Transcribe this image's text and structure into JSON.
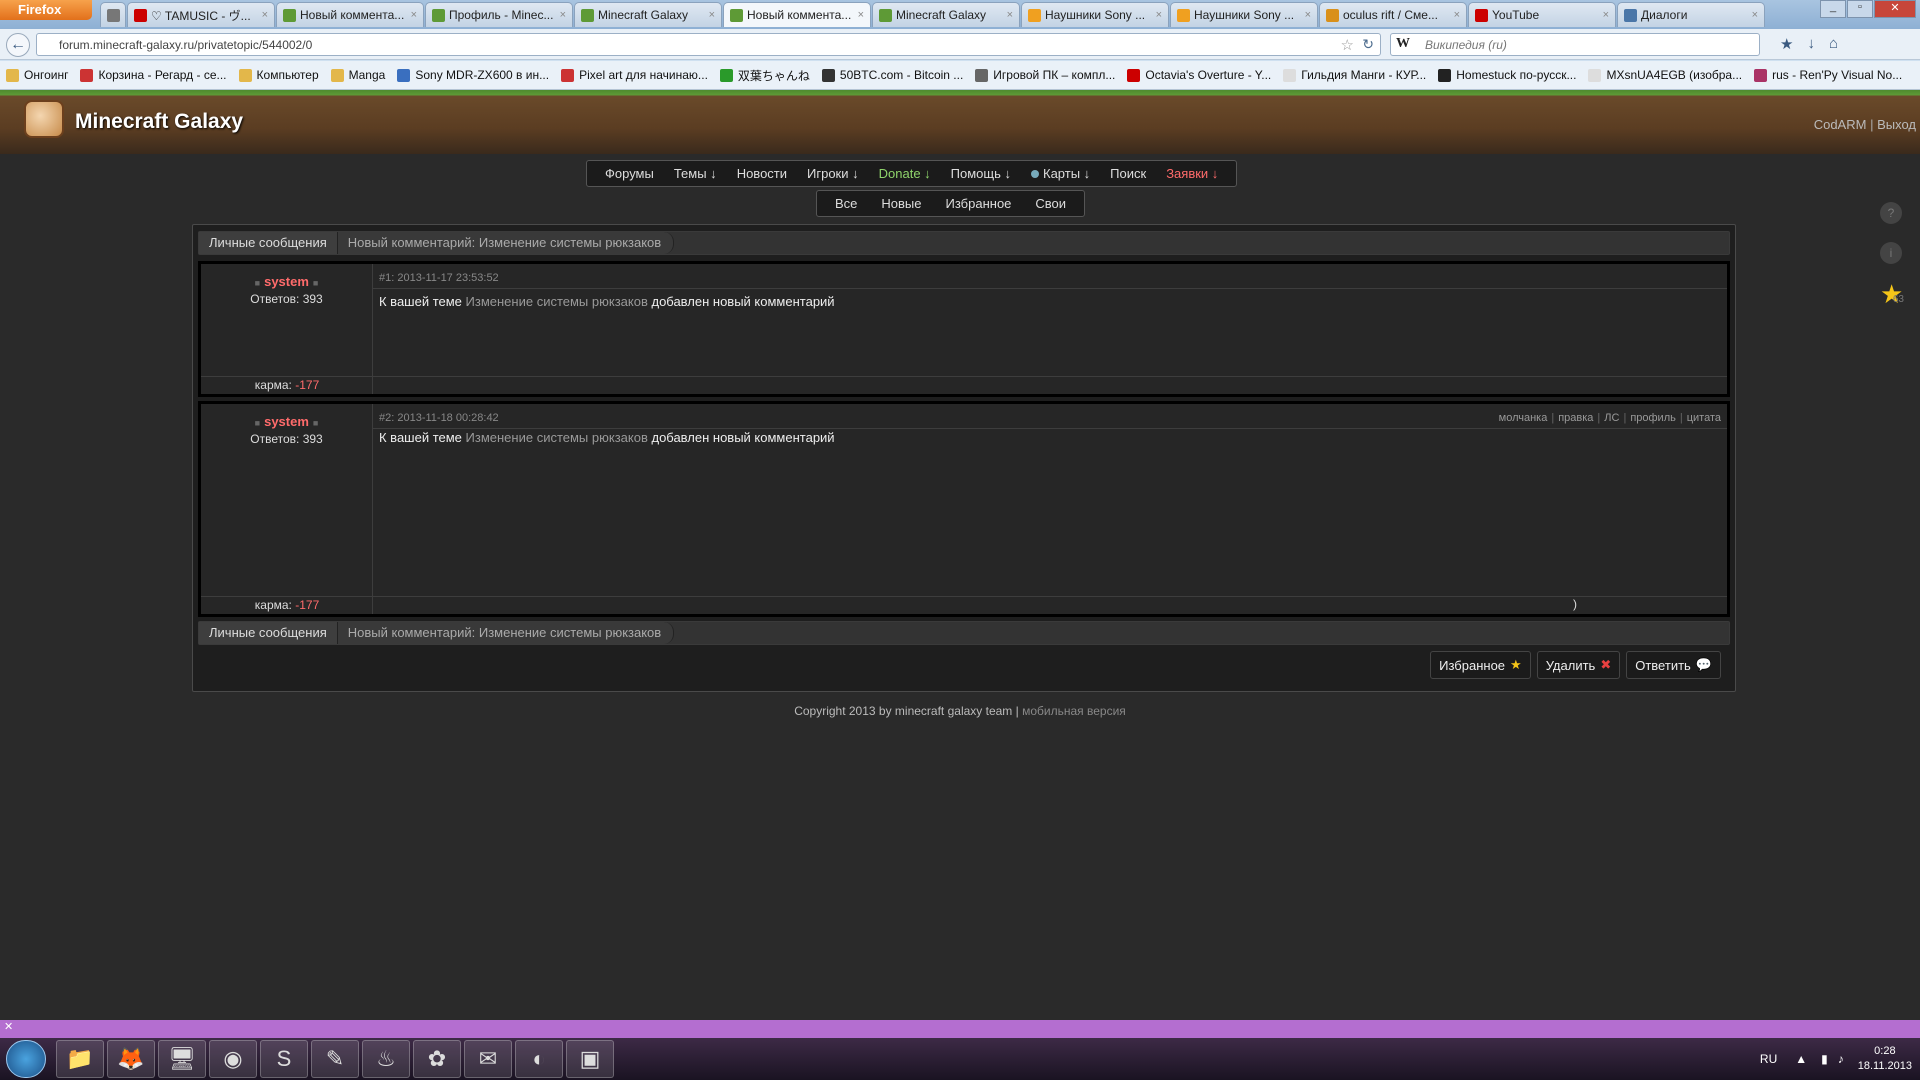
{
  "browser": {
    "menu_button": "Firefox",
    "tabs": [
      {
        "title": "♡ TAMUSIC - ヴ...",
        "favicon_color": "#cc0000"
      },
      {
        "title": "Новый коммента...",
        "favicon_color": "#5e9a36"
      },
      {
        "title": "Профиль - Minec...",
        "favicon_color": "#5e9a36"
      },
      {
        "title": "Minecraft Galaxy",
        "favicon_color": "#5e9a36"
      },
      {
        "title": "Новый коммента...",
        "favicon_color": "#5e9a36",
        "active": true
      },
      {
        "title": "Minecraft Galaxy",
        "favicon_color": "#5e9a36"
      },
      {
        "title": "Наушники Sony ...",
        "favicon_color": "#f0a020"
      },
      {
        "title": "Наушники Sony ...",
        "favicon_color": "#f0a020"
      },
      {
        "title": "oculus rift / Сме...",
        "favicon_color": "#d9901a"
      },
      {
        "title": "YouTube",
        "favicon_color": "#cc0000"
      },
      {
        "title": "Диалоги",
        "favicon_color": "#4a76a8"
      }
    ],
    "url": "forum.minecraft-galaxy.ru/privatetopic/544002/0",
    "search_placeholder": "Википедия (ru)",
    "bookmarks": [
      {
        "label": "Онгоинг",
        "color": "#e3b74a"
      },
      {
        "label": "Корзина - Регард - се...",
        "color": "#cc3333"
      },
      {
        "label": "Компьютер",
        "color": "#e3b74a"
      },
      {
        "label": "Manga",
        "color": "#e3b74a"
      },
      {
        "label": "Sony MDR-ZX600 в ин...",
        "color": "#3a6fbf"
      },
      {
        "label": "Pixel art для начинаю...",
        "color": "#cc3333"
      },
      {
        "label": "双葉ちゃんね",
        "color": "#2a9a2a"
      },
      {
        "label": "50BTC.com - Bitcoin ...",
        "color": "#333333"
      },
      {
        "label": "Игровой ПК – компл...",
        "color": "#666666"
      },
      {
        "label": "Octavia's Overture - Y...",
        "color": "#cc0000"
      },
      {
        "label": "Гильдия Манги - КУР...",
        "color": "#dddddd"
      },
      {
        "label": "Homestuck по-русск...",
        "color": "#222222"
      },
      {
        "label": "MXsnUA4EGB (изобра...",
        "color": "#dddddd"
      },
      {
        "label": "rus - Ren'Py Visual No...",
        "color": "#aa3366"
      }
    ]
  },
  "site": {
    "title": "Minecraft Galaxy",
    "user_link": "CodARM",
    "logout_link": "Выход",
    "separator": "|",
    "main_nav": [
      {
        "label": "Форумы",
        "style": "normal"
      },
      {
        "label": "Темы ↓",
        "style": "normal"
      },
      {
        "label": "Новости",
        "style": "normal"
      },
      {
        "label": "Игроки ↓",
        "style": "normal"
      },
      {
        "label": "Donate ↓",
        "style": "green"
      },
      {
        "label": "Помощь ↓",
        "style": "normal"
      },
      {
        "label": "Карты ↓",
        "style": "normal",
        "dot": true
      },
      {
        "label": "Поиск",
        "style": "normal"
      },
      {
        "label": "Заявки ↓",
        "style": "red"
      }
    ],
    "sub_nav": [
      "Все",
      "Новые",
      "Избранное",
      "Свои"
    ],
    "side_icons": {
      "help": "?",
      "info": "i",
      "star_count": "63"
    }
  },
  "topic": {
    "breadcrumb_root": "Личные сообщения",
    "breadcrumb_current": "Новый комментарий: Изменение системы рюкзаков",
    "posts": [
      {
        "author": "system",
        "replies_label": "Ответов: 393",
        "karma_label": "карма:",
        "karma_value": "-177",
        "meta": "#1: 2013-11-17 23:53:52",
        "text_before": "К вашей теме ",
        "topic_link": "Изменение системы рюкзаков",
        "text_after": " добавлен новый комментарий"
      },
      {
        "author": "system",
        "replies_label": "Ответов: 393",
        "karma_label": "карма:",
        "karma_value": "-177",
        "meta": "#2: 2013-11-18 00:28:42",
        "text_before": "К вашей теме ",
        "topic_link": "Изменение системы рюкзаков",
        "text_after": " добавлен новый комментарий",
        "actions": [
          "молчанка",
          "правка",
          "ЛС",
          "профиль",
          "цитата"
        ],
        "trailing_char": ")"
      }
    ],
    "buttons": [
      {
        "label": "Избранное",
        "icon": "★"
      },
      {
        "label": "Удалить",
        "icon": "✖"
      },
      {
        "label": "Ответить",
        "icon": "💬"
      }
    ]
  },
  "footer": {
    "copyright": "Copyright 2013 by minecraft galaxy team",
    "separator": "|",
    "mobile_link": "мобильная версия"
  },
  "taskbar": {
    "apps": [
      "folder-icon",
      "firefox-icon",
      "computer-icon",
      "chrome-icon",
      "skype-icon",
      "notepad-icon",
      "steam-icon",
      "network-icon",
      "mail-icon",
      "media-icon",
      "terminal-icon"
    ],
    "lang": "RU",
    "time": "0:28",
    "date": "18.11.2013"
  }
}
